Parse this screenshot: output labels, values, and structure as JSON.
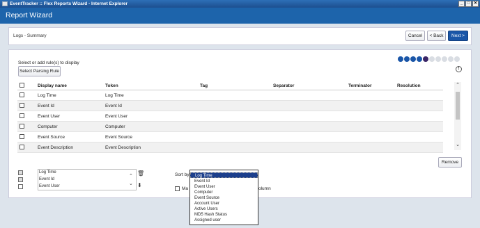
{
  "window": {
    "title": "EventTracker :: Flex Reports Wizard - Internet Explorer"
  },
  "header": {
    "title": "Report Wizard"
  },
  "step": {
    "title": "Logs - Summary",
    "cancel_label": "Cancel",
    "back_label": "< Back",
    "next_label": "Next >"
  },
  "progress": {
    "total_steps": 10,
    "completed_steps": 5,
    "current_step": 5
  },
  "instruction": "Select or add rule(s) to display",
  "select_rule_label": "Select Parsing Rule",
  "grid": {
    "columns": [
      "Display name",
      "Token",
      "Tag",
      "Separator",
      "Terminator",
      "Resolution"
    ],
    "rows": [
      {
        "display_name": "Log Time",
        "token": "Log Time"
      },
      {
        "display_name": "Event Id",
        "token": "Event Id"
      },
      {
        "display_name": "Event User",
        "token": "Event User"
      },
      {
        "display_name": "Computer",
        "token": "Computer"
      },
      {
        "display_name": "Event Source",
        "token": "Event Source"
      },
      {
        "display_name": "Event Description",
        "token": "Event Description"
      }
    ]
  },
  "remove_label": "Remove",
  "selected_columns": [
    "Log Time",
    "Event Id",
    "Event User"
  ],
  "sort": {
    "label": "Sort by",
    "options": [
      "Log Time",
      "Event Id",
      "Event User",
      "Computer",
      "Event Source",
      "Account User",
      "Active Users",
      "MD5 Hash Status",
      "Assigned user"
    ],
    "selected": "Log Time"
  },
  "map": {
    "label_start": "Ma",
    "label_end": "olumn"
  },
  "icons": {
    "info": "info-icon",
    "delete": "trash-icon",
    "move_down": "arrow-down-icon",
    "scroll_up": "chevron-up-icon",
    "scroll_down": "chevron-down-icon"
  },
  "colors": {
    "header": "#1d64ab",
    "primary_button": "#1a56a8",
    "selected_option": "#1c3f8c",
    "current_step": "#3a2566"
  }
}
